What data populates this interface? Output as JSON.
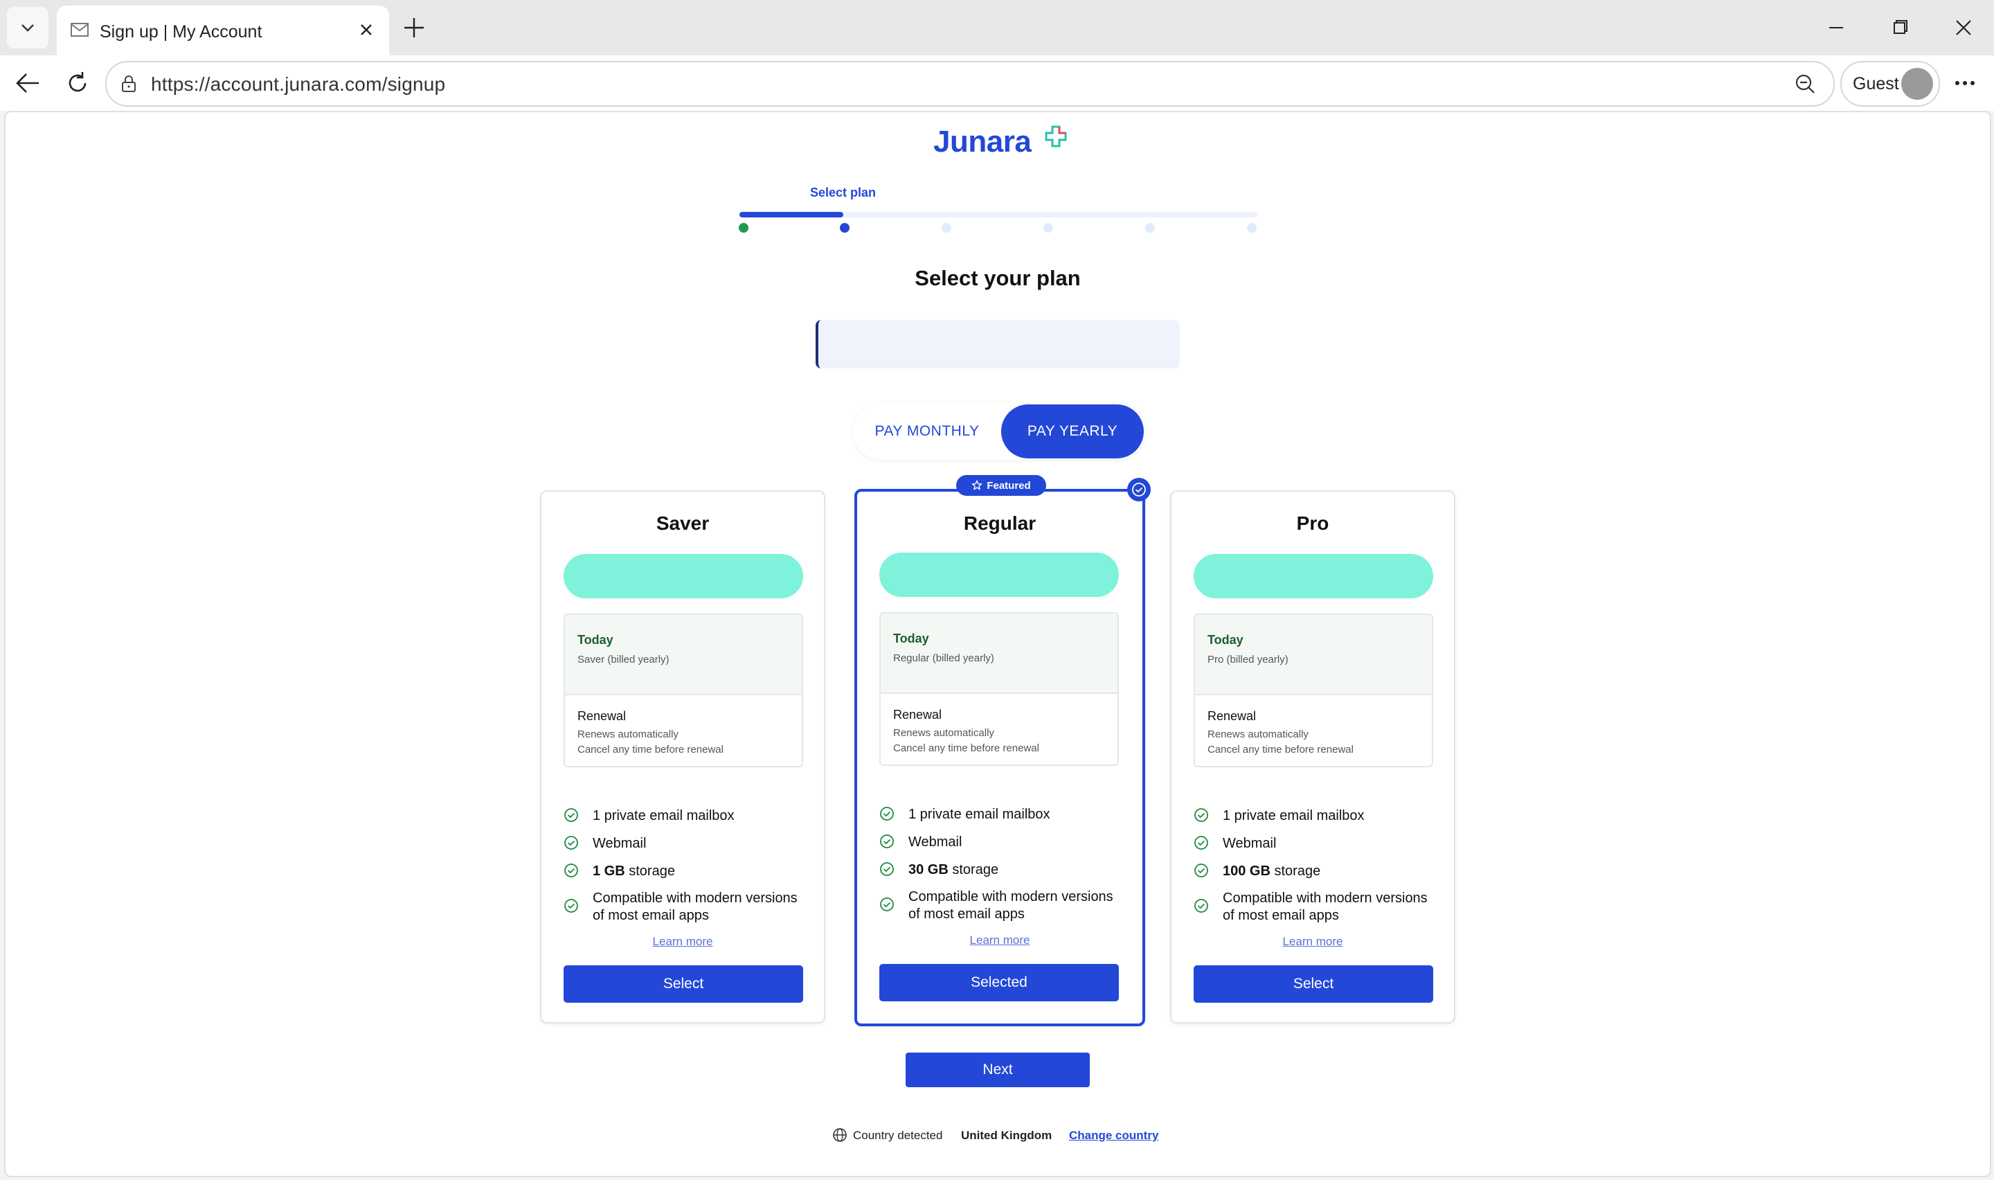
{
  "browser": {
    "tab_title": "Sign up | My Account",
    "url": "https://account.junara.com/signup",
    "profile_label": "Guest"
  },
  "page": {
    "logo_text": "Junara",
    "step_label": "Select plan",
    "title": "Select your plan",
    "billing_toggle": {
      "monthly_label": "PAY MONTHLY",
      "yearly_label": "PAY YEARLY",
      "selected": "yearly"
    },
    "featured_badge": "Featured",
    "plans": [
      {
        "name": "Saver",
        "today_label": "Today",
        "today_sub": "Saver (billed yearly)",
        "renewal_label": "Renewal",
        "renewal_line1": "Renews automatically",
        "renewal_line2": "Cancel any time before renewal",
        "features": [
          {
            "bold": "",
            "text": "1 private email mailbox"
          },
          {
            "bold": "",
            "text": "Webmail"
          },
          {
            "bold": "1 GB",
            "text": " storage"
          },
          {
            "bold": "",
            "text": "Compatible with modern versions of most email apps"
          }
        ],
        "learn_more": "Learn more",
        "button_label": "Select"
      },
      {
        "name": "Regular",
        "today_label": "Today",
        "today_sub": "Regular (billed yearly)",
        "renewal_label": "Renewal",
        "renewal_line1": "Renews automatically",
        "renewal_line2": "Cancel any time before renewal",
        "features": [
          {
            "bold": "",
            "text": "1 private email mailbox"
          },
          {
            "bold": "",
            "text": "Webmail"
          },
          {
            "bold": "30 GB",
            "text": " storage"
          },
          {
            "bold": "",
            "text": "Compatible with modern versions of most email apps"
          }
        ],
        "learn_more": "Learn more",
        "button_label": "Selected"
      },
      {
        "name": "Pro",
        "today_label": "Today",
        "today_sub": "Pro (billed yearly)",
        "renewal_label": "Renewal",
        "renewal_line1": "Renews automatically",
        "renewal_line2": "Cancel any time before renewal",
        "features": [
          {
            "bold": "",
            "text": "1 private email mailbox"
          },
          {
            "bold": "",
            "text": "Webmail"
          },
          {
            "bold": "100 GB",
            "text": " storage"
          },
          {
            "bold": "",
            "text": "Compatible with modern versions of most email apps"
          }
        ],
        "learn_more": "Learn more",
        "button_label": "Select"
      }
    ],
    "next_label": "Next",
    "country": {
      "prefix": "Country detected",
      "name": "United Kingdom",
      "change_label": "Change country"
    }
  },
  "colors": {
    "brand": "#2348d8",
    "price_pill": "#7ef2da",
    "check": "#1e8a3e"
  }
}
